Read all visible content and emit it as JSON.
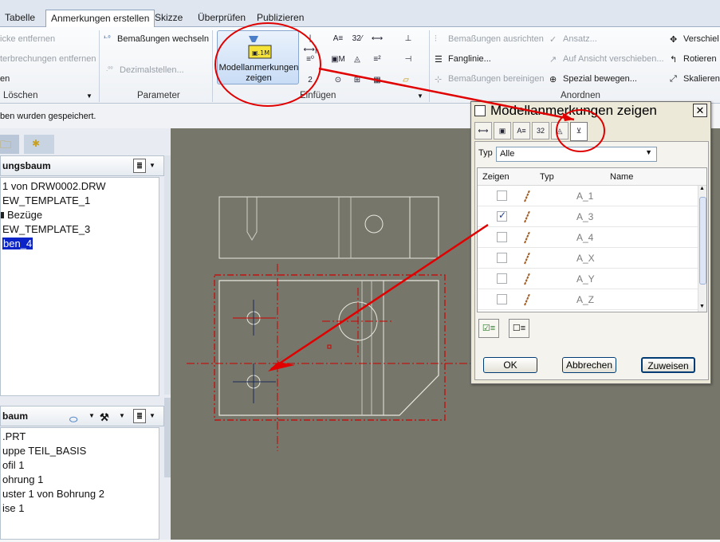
{
  "tabs": [
    "Tabelle",
    "Anmerkungen erstellen",
    "Skizze",
    "Überprüfen",
    "Publizieren"
  ],
  "ribbon": {
    "loeschen": {
      "items": [
        "icke entfernen",
        "terbrechungen entfernen",
        "en"
      ],
      "label": "Löschen"
    },
    "parameter": {
      "items": [
        "Bemaßungen wechseln",
        "Dezimalstellen..."
      ],
      "label": "Parameter"
    },
    "einfuegen": {
      "big_button": "Modellanmerkungen zeigen",
      "label": "Einfügen"
    },
    "anordnen": {
      "col1": [
        "Bemaßungen ausrichten",
        "Fanglinie...",
        "Bemaßungen bereinigen"
      ],
      "col2": [
        "Ansatz...",
        "Auf Ansicht verschieben...",
        "Spezial bewegen..."
      ],
      "col3": [
        "Verschiel",
        "Rotieren",
        "Skalieren"
      ],
      "label": "Anordnen"
    }
  },
  "status": "ben wurden gespeichert.",
  "tree1": {
    "title": "ungsbaum",
    "items": [
      "1 von DRW0002.DRW",
      "EW_TEMPLATE_1",
      "Bezüge",
      "EW_TEMPLATE_3",
      "ben_4"
    ],
    "selected_index": 4
  },
  "tree2": {
    "title": "baum",
    "items": [
      ".PRT",
      "uppe TEIL_BASIS",
      "ofil 1",
      "ohrung 1",
      "uster 1 von Bohrung 2",
      "ise 1"
    ]
  },
  "dialog": {
    "title": "Modellanmerkungen zeigen",
    "typ_label": "Typ",
    "typ_value": "Alle",
    "columns": [
      "Zeigen",
      "Typ",
      "Name"
    ],
    "rows": [
      {
        "name": "A_1",
        "checked": false
      },
      {
        "name": "A_3",
        "checked": true
      },
      {
        "name": "A_4",
        "checked": false
      },
      {
        "name": "A_X",
        "checked": false
      },
      {
        "name": "A_Y",
        "checked": false
      },
      {
        "name": "A_Z",
        "checked": false
      }
    ],
    "ok": "OK",
    "cancel": "Abbrechen",
    "apply": "Zuweisen"
  },
  "colors": {
    "annotation_red": "#e00000",
    "canvas": "#76766a",
    "selection": "#0a24c8"
  }
}
